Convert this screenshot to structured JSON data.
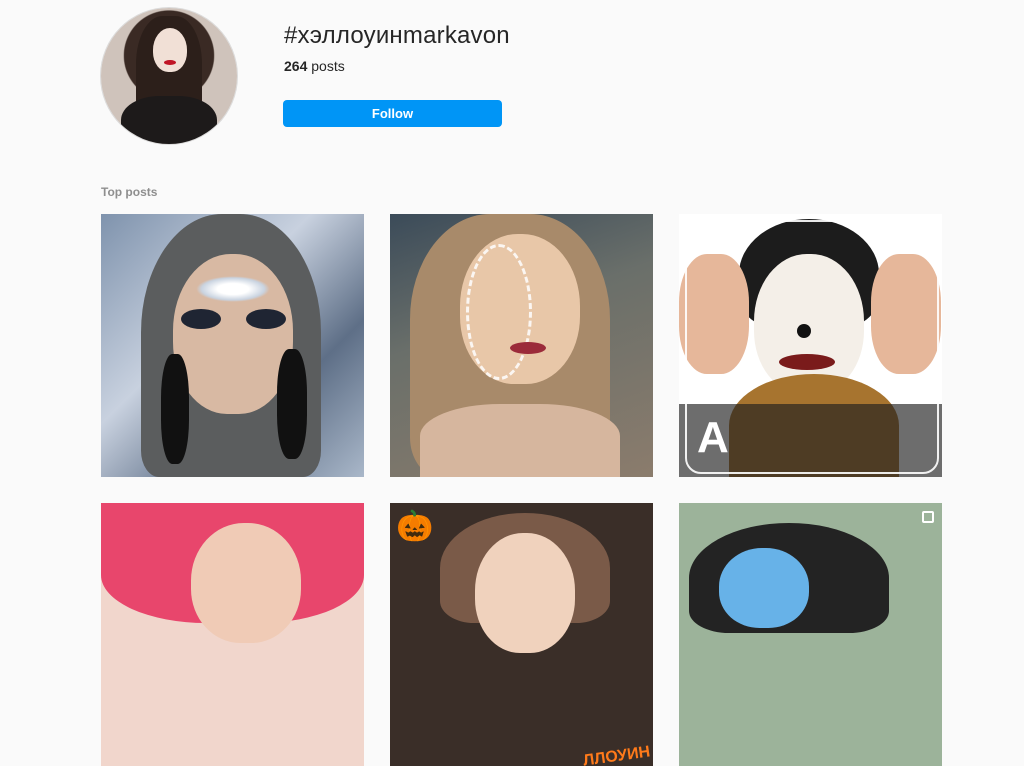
{
  "header": {
    "hashtag": "#хэллоуинmarkavon",
    "posts_count": "264",
    "posts_label": "posts",
    "follow_label": "Follow"
  },
  "sections": {
    "top_posts_label": "Top posts"
  },
  "posts": [
    {
      "name": "post-glam-crystal-makeup",
      "multi": false
    },
    {
      "name": "post-sugar-skull-makeup",
      "multi": false
    },
    {
      "name": "post-clown-makeup",
      "multi": true,
      "overlay": "A"
    },
    {
      "name": "post-pink-hair-makeup",
      "multi": false
    },
    {
      "name": "post-pumpkin-makeup",
      "multi": false,
      "caption": "ЛЛОУИН"
    },
    {
      "name": "post-blue-face-makeup",
      "multi": true
    }
  ],
  "colors": {
    "background": "#fafafa",
    "follow_button": "#0095f6",
    "muted_text": "#8e8e8e"
  }
}
